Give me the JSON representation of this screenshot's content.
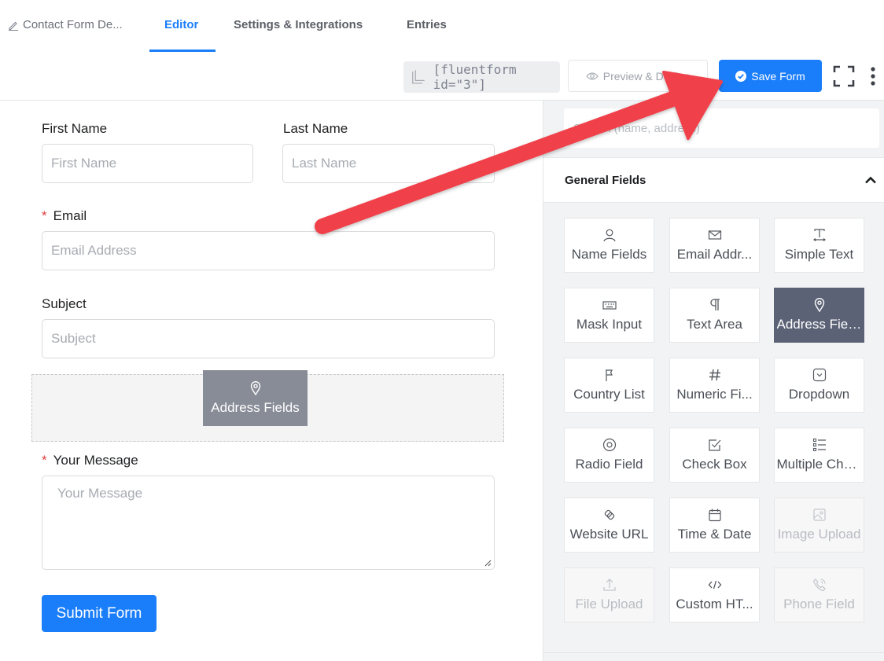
{
  "header": {
    "form_title": "Contact Form De...",
    "tabs": [
      "Editor",
      "Settings & Integrations",
      "Entries"
    ]
  },
  "toolbar": {
    "shortcode": "[fluentform id=\"3\"]",
    "preview_label": "Preview & Design",
    "save_label": "Save Form"
  },
  "form": {
    "first_name": {
      "label": "First Name",
      "placeholder": "First Name"
    },
    "last_name": {
      "label": "Last Name",
      "placeholder": "Last Name"
    },
    "email": {
      "label": "Email",
      "placeholder": "Email Address"
    },
    "subject": {
      "label": "Subject",
      "placeholder": "Subject"
    },
    "dragging_field": "Address Fields",
    "message": {
      "label": "Your Message",
      "placeholder": "Your Message"
    },
    "submit_label": "Submit Form"
  },
  "sidebar": {
    "search_placeholder": "Search (name, address)",
    "section_title": "General Fields",
    "fields": [
      {
        "label": "Name Fields",
        "icon": "user-icon",
        "state": "normal"
      },
      {
        "label": "Email Addr...",
        "icon": "envelope-icon",
        "state": "normal"
      },
      {
        "label": "Simple Text",
        "icon": "text-cursor-icon",
        "state": "normal"
      },
      {
        "label": "Mask Input",
        "icon": "keyboard-icon",
        "state": "normal"
      },
      {
        "label": "Text Area",
        "icon": "paragraph-icon",
        "state": "normal"
      },
      {
        "label": "Address Fields",
        "icon": "map-pin-icon",
        "state": "selected"
      },
      {
        "label": "Country List",
        "icon": "flag-icon",
        "state": "normal"
      },
      {
        "label": "Numeric Fi...",
        "icon": "hash-icon",
        "state": "normal"
      },
      {
        "label": "Dropdown",
        "icon": "dropdown-icon",
        "state": "normal"
      },
      {
        "label": "Radio Field",
        "icon": "radio-icon",
        "state": "normal"
      },
      {
        "label": "Check Box",
        "icon": "checkbox-icon",
        "state": "normal"
      },
      {
        "label": "Multiple Choi...",
        "icon": "list-icon",
        "state": "normal"
      },
      {
        "label": "Website URL",
        "icon": "link-icon",
        "state": "normal"
      },
      {
        "label": "Time & Date",
        "icon": "calendar-icon",
        "state": "normal"
      },
      {
        "label": "Image Upload",
        "icon": "image-icon",
        "state": "disabled"
      },
      {
        "label": "File Upload",
        "icon": "upload-icon",
        "state": "disabled"
      },
      {
        "label": "Custom HT...",
        "icon": "code-icon",
        "state": "normal"
      },
      {
        "label": "Phone Field",
        "icon": "phone-icon",
        "state": "disabled"
      }
    ]
  },
  "colors": {
    "accent": "#1a7efb",
    "selected_card": "#5b6276",
    "annotation_arrow": "#f0404a"
  }
}
